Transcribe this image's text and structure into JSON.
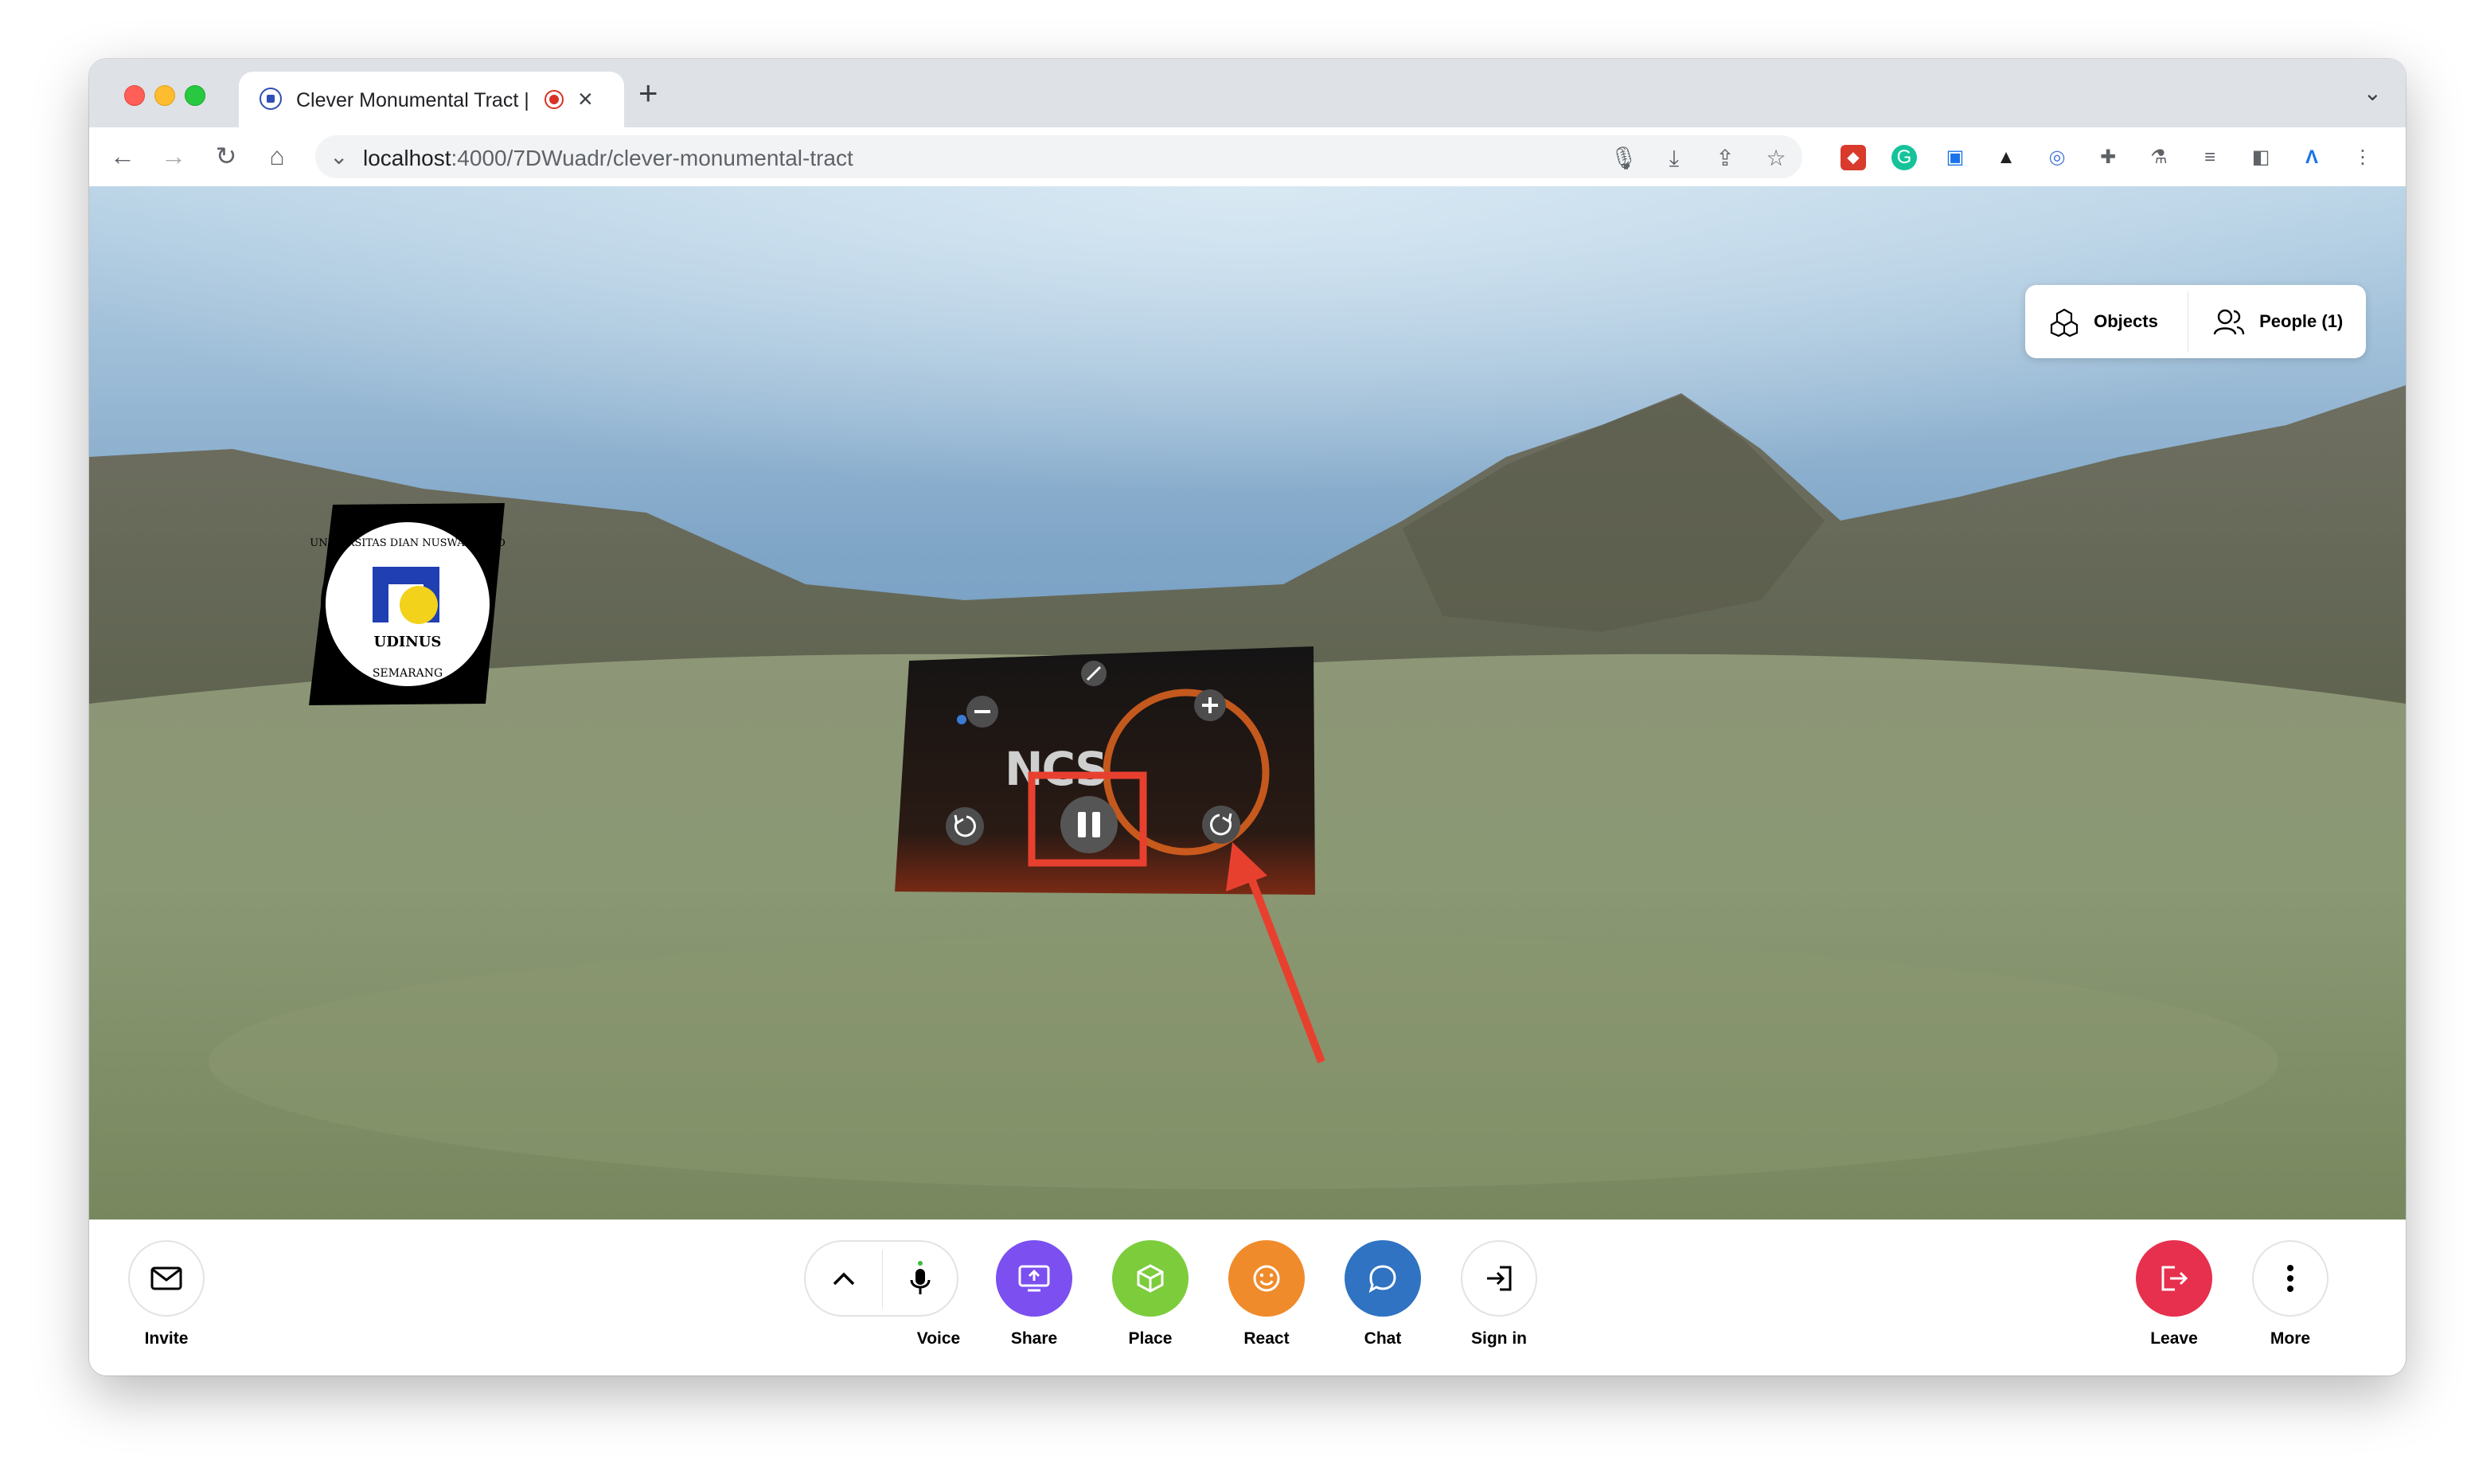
{
  "browser": {
    "tab_title": "Clever Monumental Tract |",
    "url_host": "localhost",
    "url_path": ":4000/7DWuadr/clever-monumental-tract"
  },
  "scene": {
    "logo_text_top": "UNIVERSITAS DIAN NUSWANTORO",
    "logo_text_mid": "UDINUS",
    "logo_text_bottom": "SEMARANG",
    "media_text": "NCS"
  },
  "panel": {
    "objects_label": "Objects",
    "people_label": "People (1)"
  },
  "toolbar": {
    "invite": "Invite",
    "voice": "Voice",
    "share": "Share",
    "place": "Place",
    "react": "React",
    "chat": "Chat",
    "sign_in": "Sign in",
    "leave": "Leave",
    "more": "More"
  },
  "colors": {
    "share": "#7b4ff0",
    "place": "#7ccc3c",
    "react": "#f08b2c",
    "chat": "#2f73c2",
    "leave": "#e6304d",
    "annotation": "#e8402f"
  }
}
